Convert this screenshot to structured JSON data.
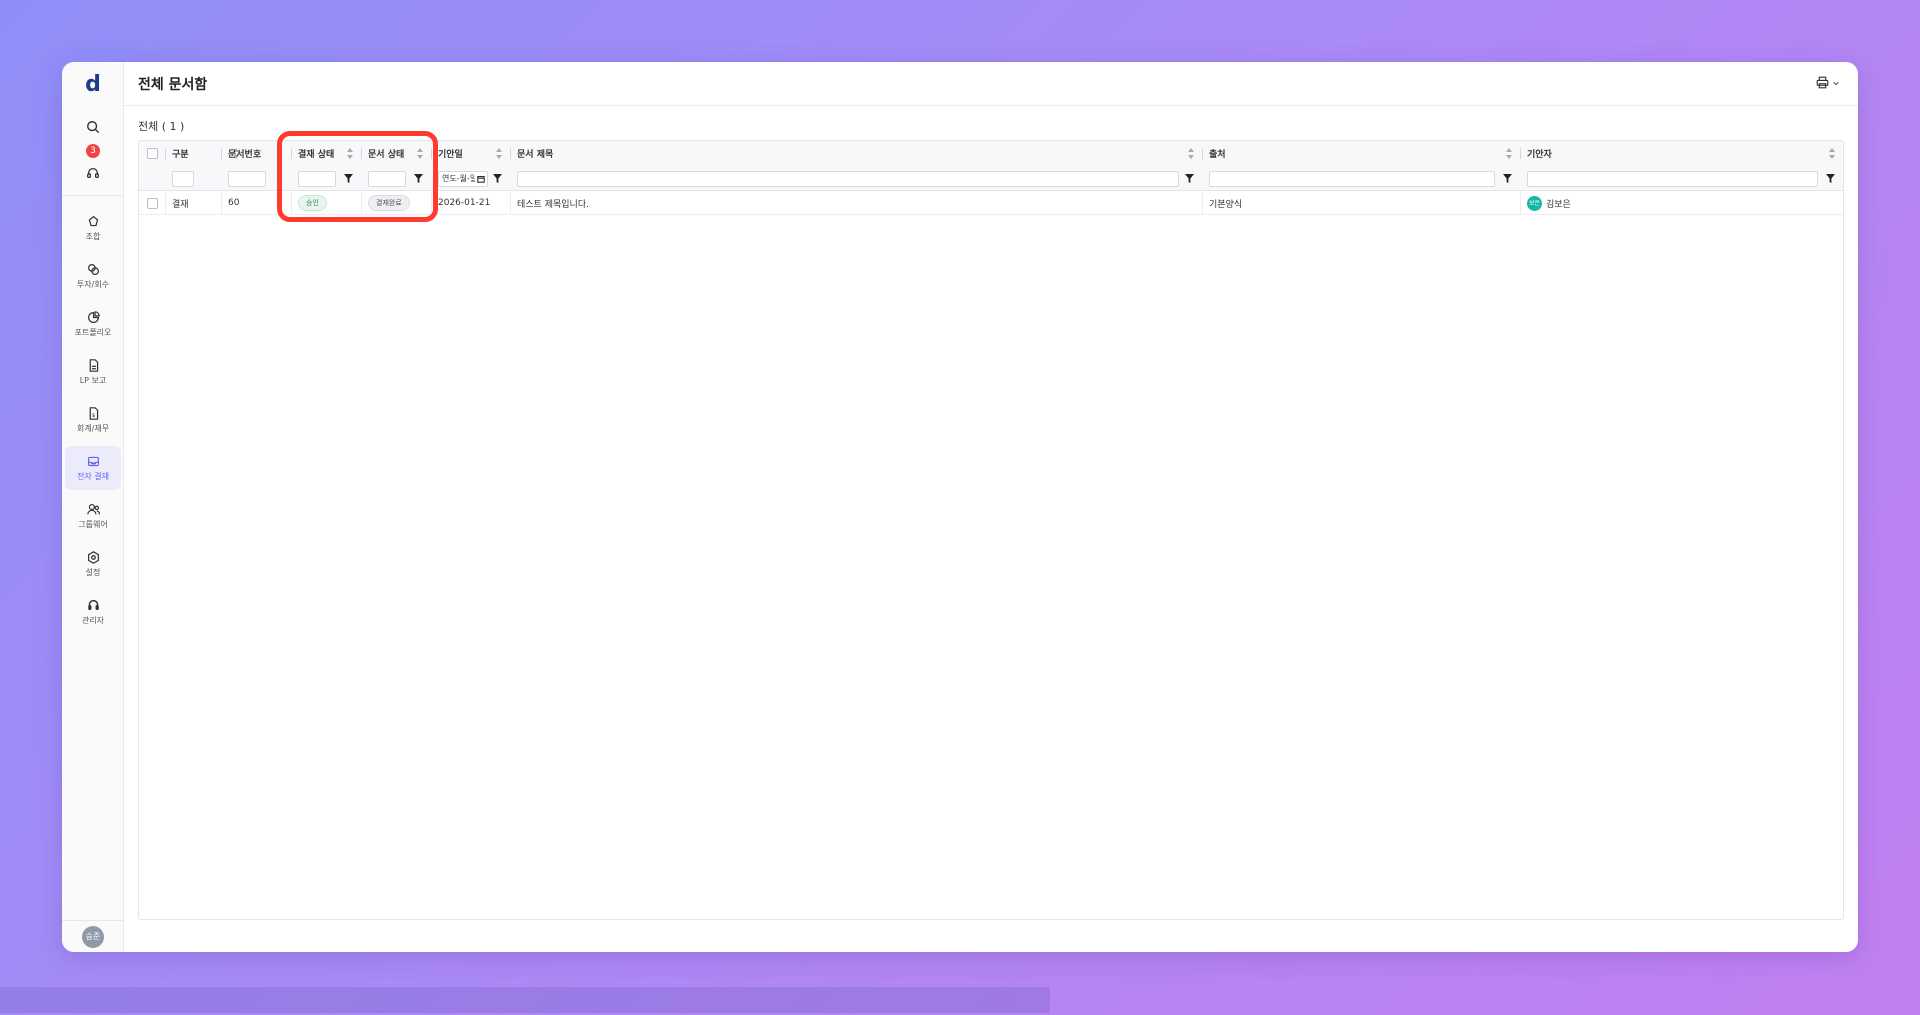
{
  "app": {
    "logo": "d",
    "badge_count": "3",
    "user_avatar": "승준"
  },
  "nav": {
    "items": [
      {
        "label": "조합",
        "icon": "union-icon"
      },
      {
        "label": "투자/회수",
        "icon": "investment-icon"
      },
      {
        "label": "포트폴리오",
        "icon": "portfolio-icon"
      },
      {
        "label": "LP 보고",
        "icon": "report-icon"
      },
      {
        "label": "회계/재무",
        "icon": "accounting-icon"
      },
      {
        "label": "전자 결재",
        "icon": "approval-icon",
        "active": true
      },
      {
        "label": "그룹웨어",
        "icon": "groupware-icon"
      },
      {
        "label": "설정",
        "icon": "settings-icon"
      },
      {
        "label": "관리자",
        "icon": "admin-icon"
      }
    ]
  },
  "header": {
    "title": "전체 문서함"
  },
  "list": {
    "count_label": "전체 ( 1 )",
    "columns": {
      "type": "구분",
      "doc_no": "문서번호",
      "approval_status": "결재 상태",
      "doc_status": "문서 상태",
      "draft_date": "기안일",
      "doc_title": "문서 제목",
      "source": "출처",
      "drafter": "기안자"
    },
    "filters": {
      "date_placeholder": "연도-월-일"
    },
    "rows": [
      {
        "type": "결재",
        "doc_no": "60",
        "approval_status": "승인",
        "doc_status": "결재완료",
        "draft_date": "2026-01-21",
        "doc_title": "테스트 제목입니다.",
        "source": "기본양식",
        "drafter_initials": "보은",
        "drafter": "김보은"
      }
    ]
  },
  "colors": {
    "accent": "#6366f1",
    "highlight": "#ff3b30",
    "approved_green": "#2e8b57",
    "badge_red": "#ef4444"
  }
}
